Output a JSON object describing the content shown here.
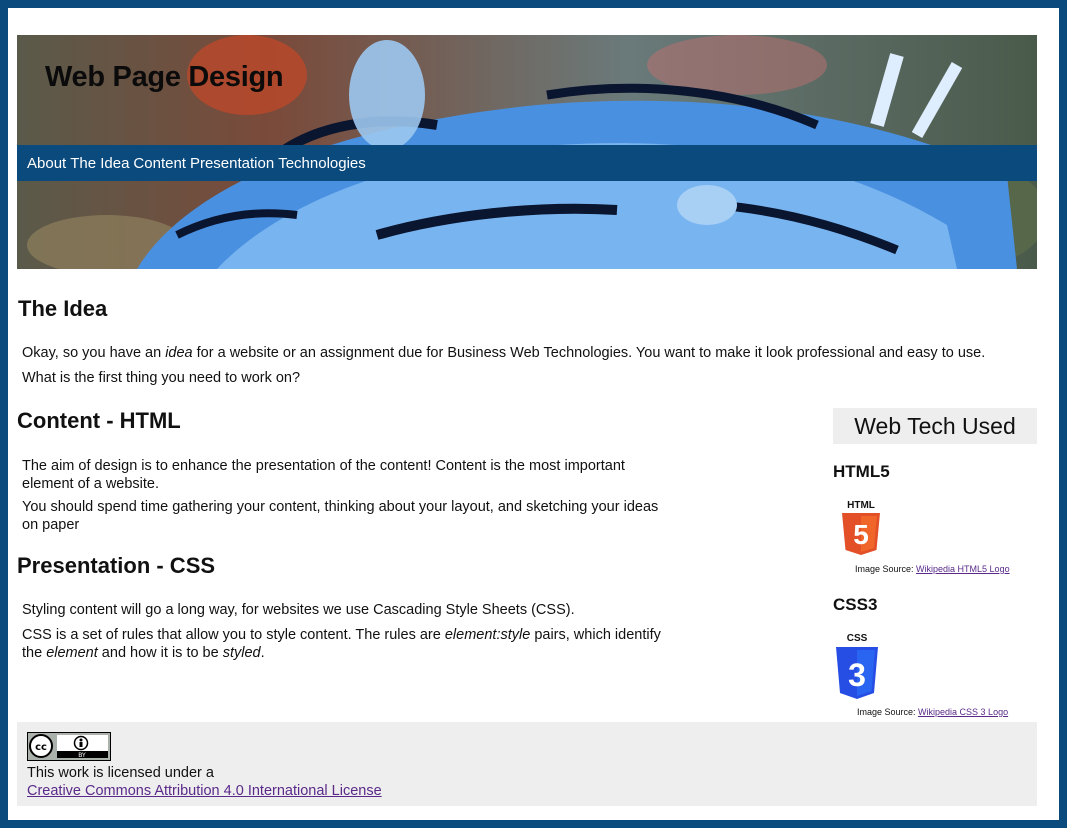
{
  "header": {
    "title": "Web Page Design",
    "nav": [
      "About",
      "The Idea",
      "Content",
      "Presentation",
      "Technologies"
    ]
  },
  "idea": {
    "heading": "The Idea",
    "line1_before": "Okay, so you have an ",
    "line1_em": "idea",
    "line1_after": " for a website or an assignment due for Business Web Technologies. You want to make it look professional and easy to use.",
    "line2": "What is the first thing you need to work on?"
  },
  "content": {
    "heading": "Content - HTML",
    "p1": "The aim of design is to enhance the presentation of the content! Content is the most important element of a website.",
    "p2": "You should spend time gathering your content, thinking about your layout, and sketching your ideas on paper"
  },
  "presentation": {
    "heading": "Presentation - CSS",
    "p1": "Styling content will go a long way, for websites we use Cascading Style Sheets (CSS).",
    "p2_before": "CSS is a set of rules that allow you to style content. The rules are ",
    "p2_em1": "element:style",
    "p2_mid1": " pairs, which identify the ",
    "p2_em2": "element",
    "p2_mid2": " and how it is to be ",
    "p2_em3": "styled",
    "p2_end": "."
  },
  "sidebar": {
    "heading": "Web Tech Used",
    "html5": {
      "name": "HTML5",
      "logo_word": "HTML",
      "logo_digit": "5",
      "source_label": "Image Source: ",
      "source_link": "Wikipedia HTML5 Logo"
    },
    "css3": {
      "name": "CSS3",
      "logo_word": "CSS",
      "logo_digit": "3",
      "source_label": "Image Source: ",
      "source_link": "Wikipedia CSS 3 Logo"
    }
  },
  "footer": {
    "badge_cc": "cc",
    "badge_by": "BY",
    "license_text": "This work is licensed under a",
    "license_link": "Creative Commons Attribution 4.0 International License"
  },
  "colors": {
    "frame": "#0b4a7c",
    "nav_bg": "#0b4a7c",
    "html5_orange": "#e34f26",
    "css3_blue": "#264de4",
    "link_visited": "#5a2a8a",
    "panel_gray": "#eeeeee"
  }
}
